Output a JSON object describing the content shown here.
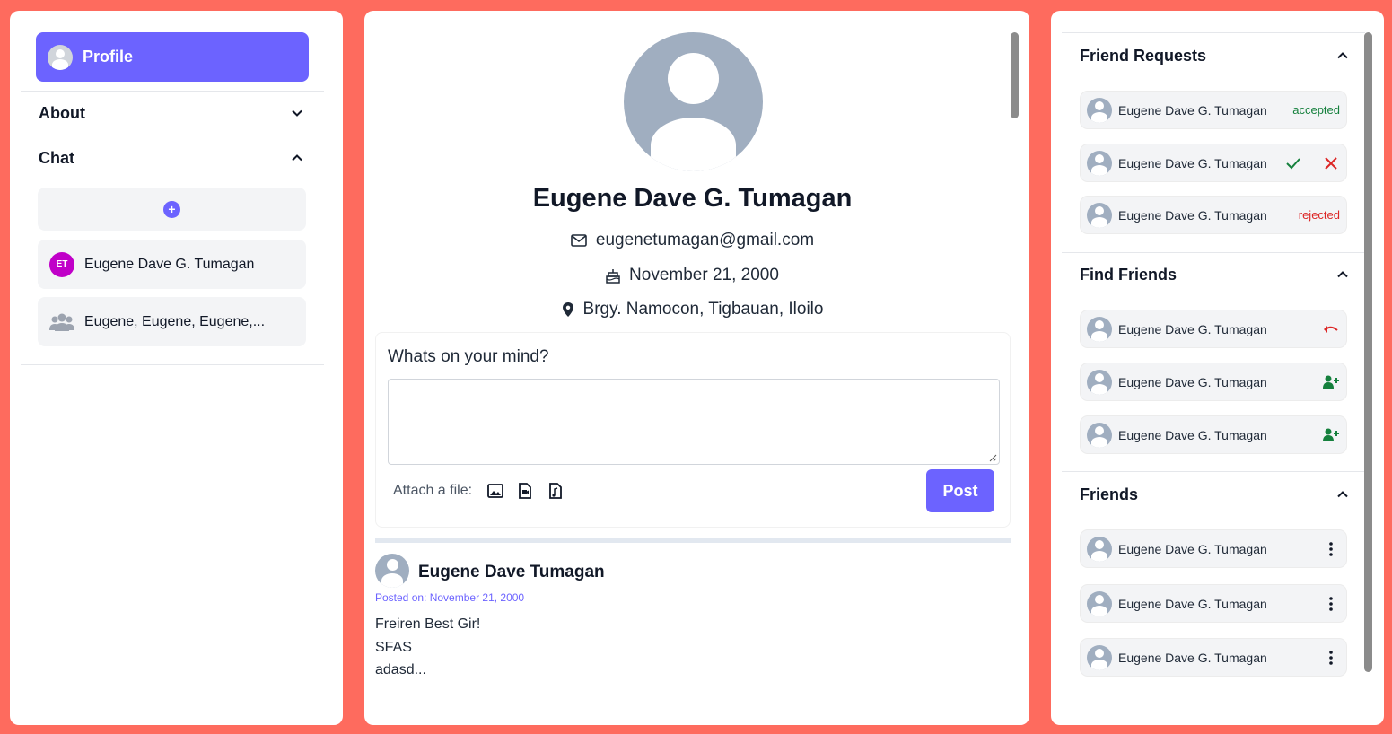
{
  "left": {
    "profile_label": "Profile",
    "about_label": "About",
    "chat_label": "Chat",
    "chats": [
      {
        "initials": "ET",
        "name": "Eugene Dave G. Tumagan"
      },
      {
        "name": "Eugene, Eugene, Eugene,..."
      }
    ]
  },
  "center": {
    "name": "Eugene Dave G. Tumagan",
    "email": "eugenetumagan@gmail.com",
    "birthday": "November 21, 2000",
    "address": "Brgy. Namocon, Tigbauan, Iloilo",
    "post_prompt": "Whats on your mind?",
    "attach_label": "Attach a file:",
    "post_button": "Post",
    "post": {
      "author": "Eugene Dave Tumagan",
      "date": "Posted on: November 21, 2000",
      "lines": [
        "Freiren Best Gir!",
        "SFAS",
        "adasd..."
      ]
    }
  },
  "right": {
    "friend_requests_title": "Friend Requests",
    "find_friends_title": "Find Friends",
    "friends_title": "Friends",
    "friend_requests": [
      {
        "name": "Eugene Dave G. Tumagan",
        "status": "accepted"
      },
      {
        "name": "Eugene Dave G. Tumagan",
        "status": ""
      },
      {
        "name": "Eugene Dave G. Tumagan",
        "status": "rejected"
      }
    ],
    "find_friends": [
      {
        "name": "Eugene Dave G. Tumagan"
      },
      {
        "name": "Eugene Dave G. Tumagan"
      },
      {
        "name": "Eugene Dave G. Tumagan"
      }
    ],
    "friends": [
      {
        "name": "Eugene Dave G. Tumagan"
      },
      {
        "name": "Eugene Dave G. Tumagan"
      },
      {
        "name": "Eugene Dave G. Tumagan"
      }
    ]
  },
  "colors": {
    "background": "#fe6b5e",
    "accent": "#6c63ff",
    "accepted": "#15803d",
    "rejected": "#dc2626",
    "avatar_gray": "#a0aec0",
    "chat_avatar": "#c000c8"
  }
}
